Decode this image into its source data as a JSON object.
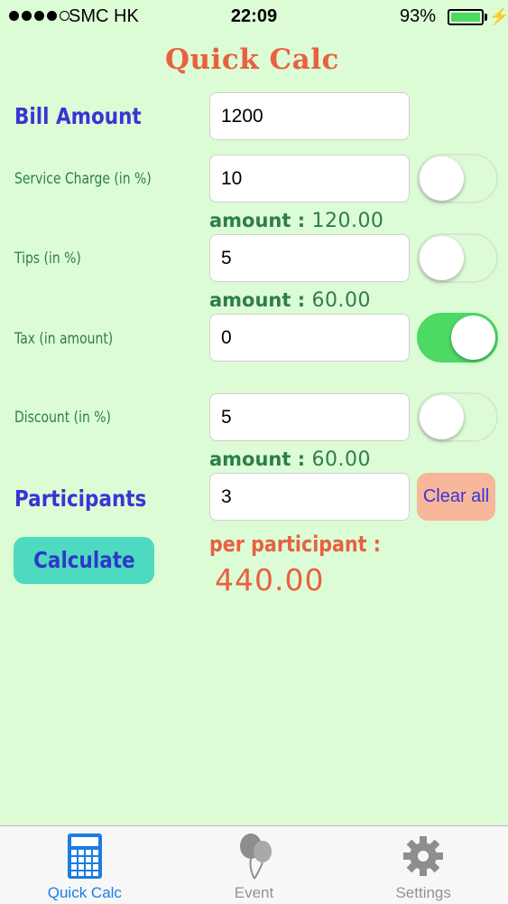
{
  "status_bar": {
    "carrier": "SMC HK",
    "time": "22:09",
    "battery_percent": "93%",
    "signal_bars_filled": 4,
    "signal_bars_total": 5
  },
  "title": "Quick Calc",
  "bill": {
    "label": "Bill Amount",
    "value": "1200"
  },
  "service_charge": {
    "label": "Service Charge (in %)",
    "value": "10",
    "toggle_on": false,
    "amount_label": "amount : ",
    "amount_value": "120.00"
  },
  "tips": {
    "label": "Tips (in %)",
    "value": "5",
    "toggle_on": false,
    "amount_label": "amount : ",
    "amount_value": "60.00"
  },
  "tax": {
    "label": "Tax (in amount)",
    "value": "0",
    "toggle_on": true
  },
  "discount": {
    "label": "Discount (in %)",
    "value": "5",
    "toggle_on": false,
    "amount_label": "amount : ",
    "amount_value": "60.00"
  },
  "participants": {
    "label": "Participants",
    "value": "3"
  },
  "buttons": {
    "clear": "Clear all",
    "calculate": "Calculate"
  },
  "result": {
    "label": "per participant :",
    "value": "440.00"
  },
  "tabs": [
    {
      "label": "Quick Calc",
      "icon": "calculator-icon",
      "active": true
    },
    {
      "label": "Event",
      "icon": "balloons-icon",
      "active": false
    },
    {
      "label": "Settings",
      "icon": "gear-icon",
      "active": false
    }
  ],
  "colors": {
    "background": "#dcfcd6",
    "title": "#e8613f",
    "label_blue": "#3a34d4",
    "label_green": "#2e7d4c",
    "toggle_on": "#4cd964",
    "clear_button": "#f7b79a",
    "calculate_button": "#4ddac0",
    "tab_active": "#1a7de3"
  }
}
